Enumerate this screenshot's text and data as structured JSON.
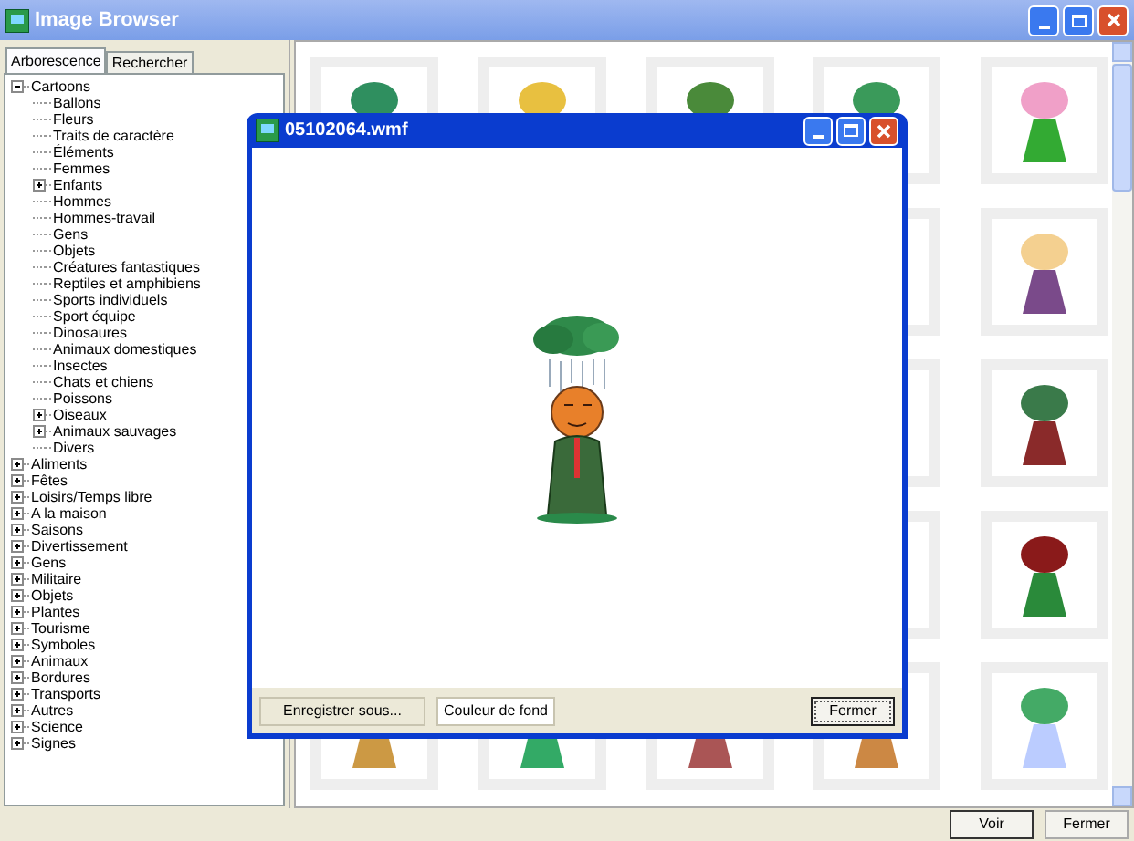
{
  "window": {
    "title": "Image Browser"
  },
  "tabs": [
    {
      "label": "Arborescence",
      "selected": true
    },
    {
      "label": "Rechercher",
      "selected": false
    }
  ],
  "tree": [
    {
      "label": "Cartoons",
      "expanded": true,
      "children": [
        {
          "label": "Ballons"
        },
        {
          "label": "Fleurs"
        },
        {
          "label": "Traits de caractère"
        },
        {
          "label": "Éléments"
        },
        {
          "label": "Femmes"
        },
        {
          "label": "Enfants",
          "expanded": false
        },
        {
          "label": "Hommes"
        },
        {
          "label": "Hommes-travail"
        },
        {
          "label": "Gens"
        },
        {
          "label": "Objets"
        },
        {
          "label": "Créatures fantastiques"
        },
        {
          "label": "Reptiles et amphibiens"
        },
        {
          "label": "Sports individuels"
        },
        {
          "label": "Sport équipe"
        },
        {
          "label": "Dinosaures"
        },
        {
          "label": "Animaux domestiques"
        },
        {
          "label": "Insectes"
        },
        {
          "label": "Chats et chiens"
        },
        {
          "label": "Poissons"
        },
        {
          "label": "Oiseaux",
          "expanded": false
        },
        {
          "label": "Animaux sauvages",
          "expanded": false
        },
        {
          "label": "Divers"
        }
      ]
    },
    {
      "label": "Aliments",
      "expanded": false
    },
    {
      "label": "Fêtes",
      "expanded": false
    },
    {
      "label": "Loisirs/Temps libre",
      "expanded": false
    },
    {
      "label": "A la maison",
      "expanded": false
    },
    {
      "label": "Saisons",
      "expanded": false
    },
    {
      "label": "Divertissement",
      "expanded": false
    },
    {
      "label": "Gens",
      "expanded": false
    },
    {
      "label": "Militaire",
      "expanded": false
    },
    {
      "label": "Objets",
      "expanded": false
    },
    {
      "label": "Plantes",
      "expanded": false
    },
    {
      "label": "Tourisme",
      "expanded": false
    },
    {
      "label": "Symboles",
      "expanded": false
    },
    {
      "label": "Animaux",
      "expanded": false
    },
    {
      "label": "Bordures",
      "expanded": false
    },
    {
      "label": "Transports",
      "expanded": false
    },
    {
      "label": "Autres",
      "expanded": false
    },
    {
      "label": "Science",
      "expanded": false
    },
    {
      "label": "Signes",
      "expanded": false
    }
  ],
  "dialog": {
    "title": "05102064.wmf",
    "buttons": [
      {
        "label": "Enregistrer sous...",
        "kind": "plain"
      },
      {
        "label": "Couleur de fond",
        "kind": "white"
      },
      {
        "label": "Fermer",
        "kind": "default"
      }
    ]
  },
  "buttons": [
    "Voir",
    "Fermer"
  ]
}
